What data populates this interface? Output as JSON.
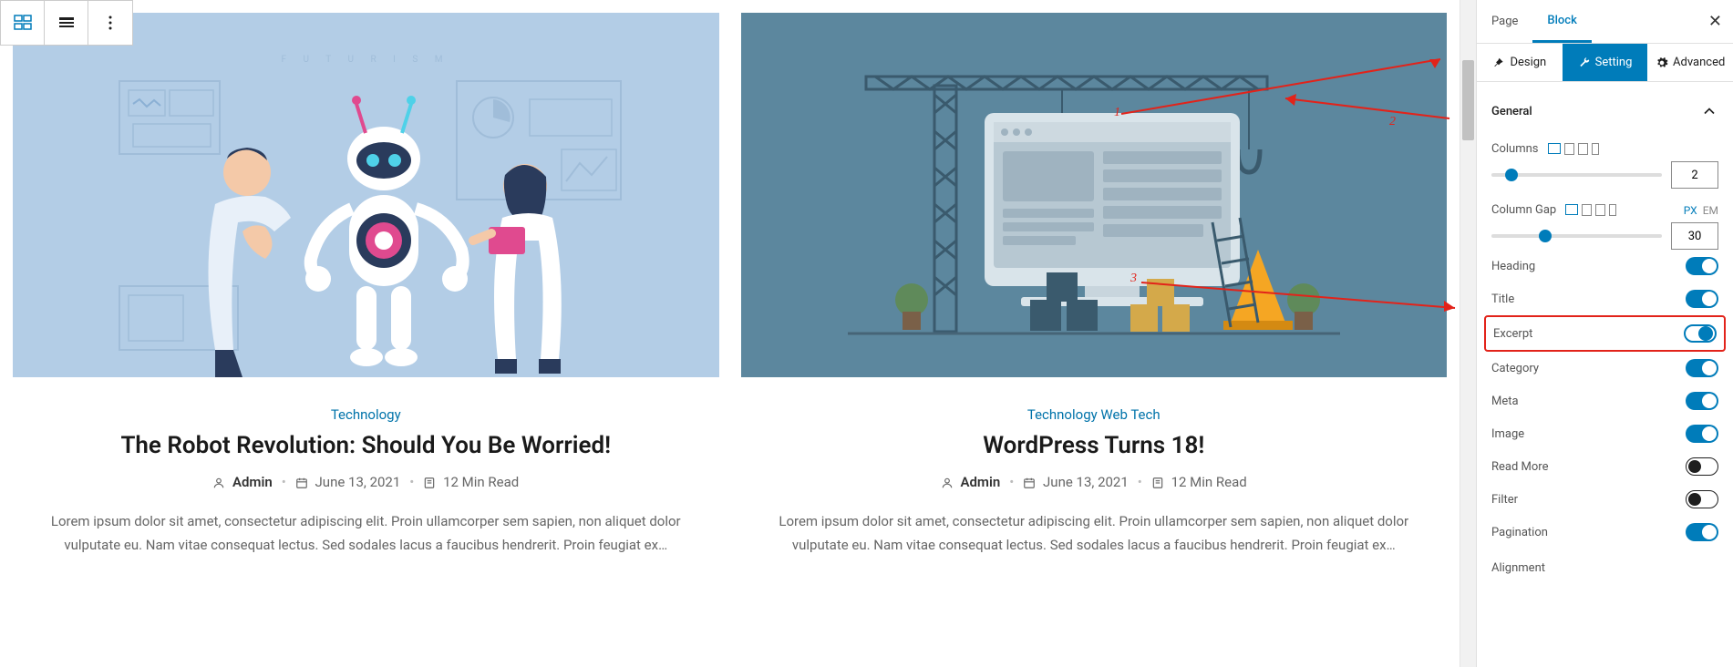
{
  "sidebar": {
    "top_tabs": {
      "page": "Page",
      "block": "Block"
    },
    "sub_tabs": {
      "design": "Design",
      "setting": "Setting",
      "advanced": "Advanced"
    },
    "section_title": "General",
    "columns": {
      "label": "Columns",
      "value": "2"
    },
    "column_gap": {
      "label": "Column Gap",
      "value": "30",
      "unit_px": "PX",
      "unit_em": "EM"
    },
    "toggles": {
      "heading": "Heading",
      "title": "Title",
      "excerpt": "Excerpt",
      "category": "Category",
      "meta": "Meta",
      "image": "Image",
      "read_more": "Read More",
      "filter": "Filter",
      "pagination": "Pagination"
    },
    "alignment": "Alignment"
  },
  "posts": [
    {
      "category": "Technology",
      "title": "The Robot Revolution: Should You Be Worried!",
      "author": "Admin",
      "date": "June 13, 2021",
      "read_time": "12 Min Read",
      "excerpt": "Lorem ipsum dolor sit amet, consectetur adipiscing elit. Proin ullamcorper sem sapien, non aliquet dolor vulputate eu. Nam vitae consequat lectus. Sed sodales lacus a faucibus hendrerit. Proin feugiat ex…"
    },
    {
      "category": "Technology Web Tech",
      "title": "WordPress Turns 18!",
      "author": "Admin",
      "date": "June 13, 2021",
      "read_time": "12 Min Read",
      "excerpt": "Lorem ipsum dolor sit amet, consectetur adipiscing elit. Proin ullamcorper sem sapien, non aliquet dolor vulputate eu. Nam vitae consequat lectus. Sed sodales lacus a faucibus hendrerit. Proin feugiat ex…"
    }
  ],
  "annotations": {
    "a1": "1",
    "a2": "2",
    "a3": "3"
  }
}
